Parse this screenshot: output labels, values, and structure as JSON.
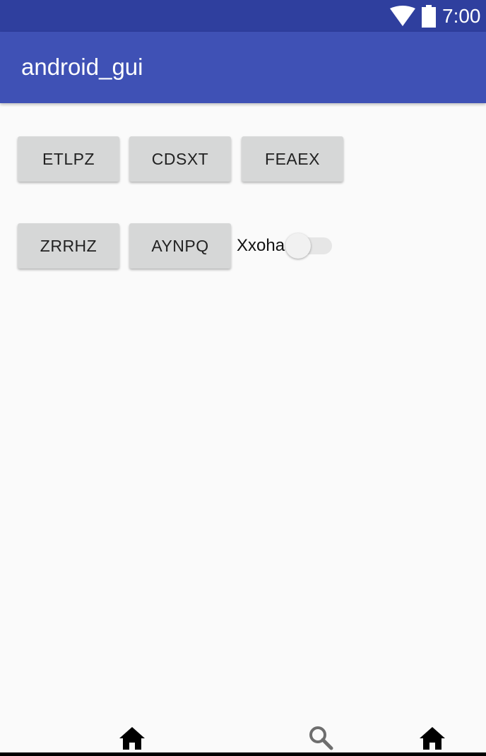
{
  "status_bar": {
    "time": "7:00",
    "icons": [
      "wifi-icon",
      "battery-icon"
    ]
  },
  "app_bar": {
    "title": "android_gui"
  },
  "buttons": [
    {
      "label": "ETLPZ"
    },
    {
      "label": "CDSXT"
    },
    {
      "label": "FEAEX"
    },
    {
      "label": "ZRRHZ"
    },
    {
      "label": "AYNPQ"
    }
  ],
  "switch": {
    "label": "Xxoha",
    "checked": false
  },
  "bottom_nav": {
    "icons": [
      "home-icon",
      "search-icon",
      "home-icon"
    ]
  },
  "colors": {
    "status_bar": "#2f3f9e",
    "app_bar": "#3f51b5",
    "background": "#fafafa",
    "button": "#d6d7d7"
  }
}
